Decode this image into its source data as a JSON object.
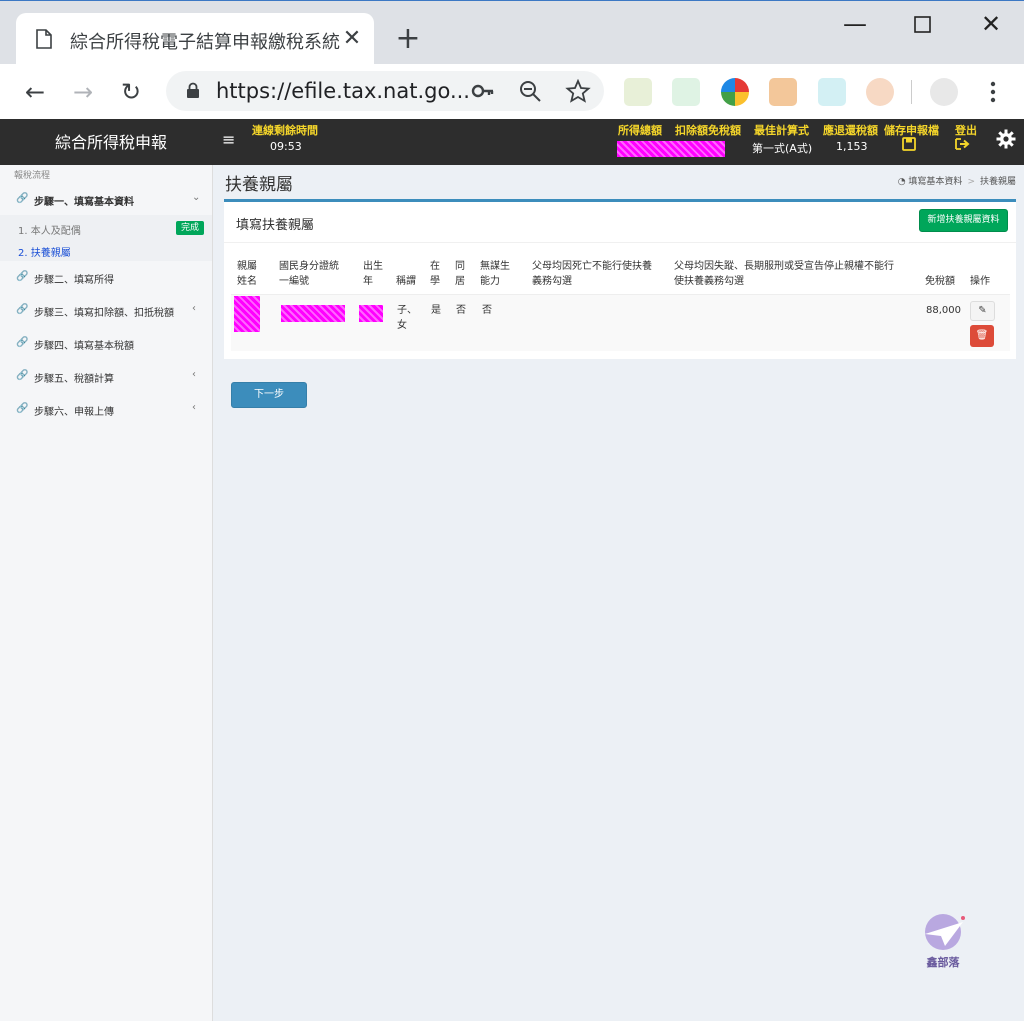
{
  "browser": {
    "tab_title": "綜合所得稅電子結算申報繳稅系統",
    "url": "https://efile.tax.nat.go..."
  },
  "header": {
    "brand": "綜合所得稅申報",
    "session_label": "連線剩餘時間",
    "session_value": "09:53",
    "income_label": "所得總額",
    "deduction_label": "扣除額免稅額",
    "best_calc_label": "最佳計算式",
    "best_calc_value": "第一式(A式)",
    "refund_label": "應退還稅額",
    "refund_value": "1,153",
    "save_label": "儲存申報檔",
    "logout_label": "登出"
  },
  "sidebar": {
    "caption": "報稅流程",
    "steps": [
      {
        "label": "步驟一、填寫基本資料"
      },
      {
        "label": "步驟二、填寫所得"
      },
      {
        "label": "步驟三、填寫扣除額、扣抵稅額"
      },
      {
        "label": "步驟四、填寫基本稅額"
      },
      {
        "label": "步驟五、稅額計算"
      },
      {
        "label": "步驟六、申報上傳"
      }
    ],
    "sub": [
      {
        "label": "1. 本人及配偶",
        "badge": "完成"
      },
      {
        "label": "2. 扶養親屬"
      }
    ]
  },
  "page": {
    "title": "扶養親屬",
    "breadcrumb": [
      "填寫基本資料",
      "扶養親屬"
    ]
  },
  "panel": {
    "title": "填寫扶養親屬",
    "add_button": "新增扶養親屬資料",
    "columns": [
      [
        "親屬",
        "姓名"
      ],
      [
        "國民身分證統",
        "一編號"
      ],
      [
        "出生",
        "年"
      ],
      [
        "",
        "稱謂"
      ],
      [
        "在",
        "學"
      ],
      [
        "同",
        "居"
      ],
      [
        "無謀生",
        "能力"
      ],
      [
        "父母均因死亡不能行使扶養",
        "義務勾選"
      ],
      [
        "父母均因失蹤、長期服刑或受宣告停止親權不能行",
        "使扶養義務勾選"
      ],
      [
        "",
        "免稅額"
      ],
      [
        "",
        "操作"
      ]
    ],
    "row": {
      "title_line1": "子、",
      "title_line2": "女",
      "in_school": "是",
      "cohabit": "否",
      "unable": "否",
      "exemption": "88,000"
    }
  },
  "next_button": "下一步",
  "watermark": "鑫部落",
  "colors": {
    "header_bg": "#2d2d2d",
    "header_label": "#f4d52a",
    "primary": "#3c8dbc",
    "success": "#00a65a",
    "danger": "#dd4b39",
    "redaction": "#ff00ff"
  }
}
